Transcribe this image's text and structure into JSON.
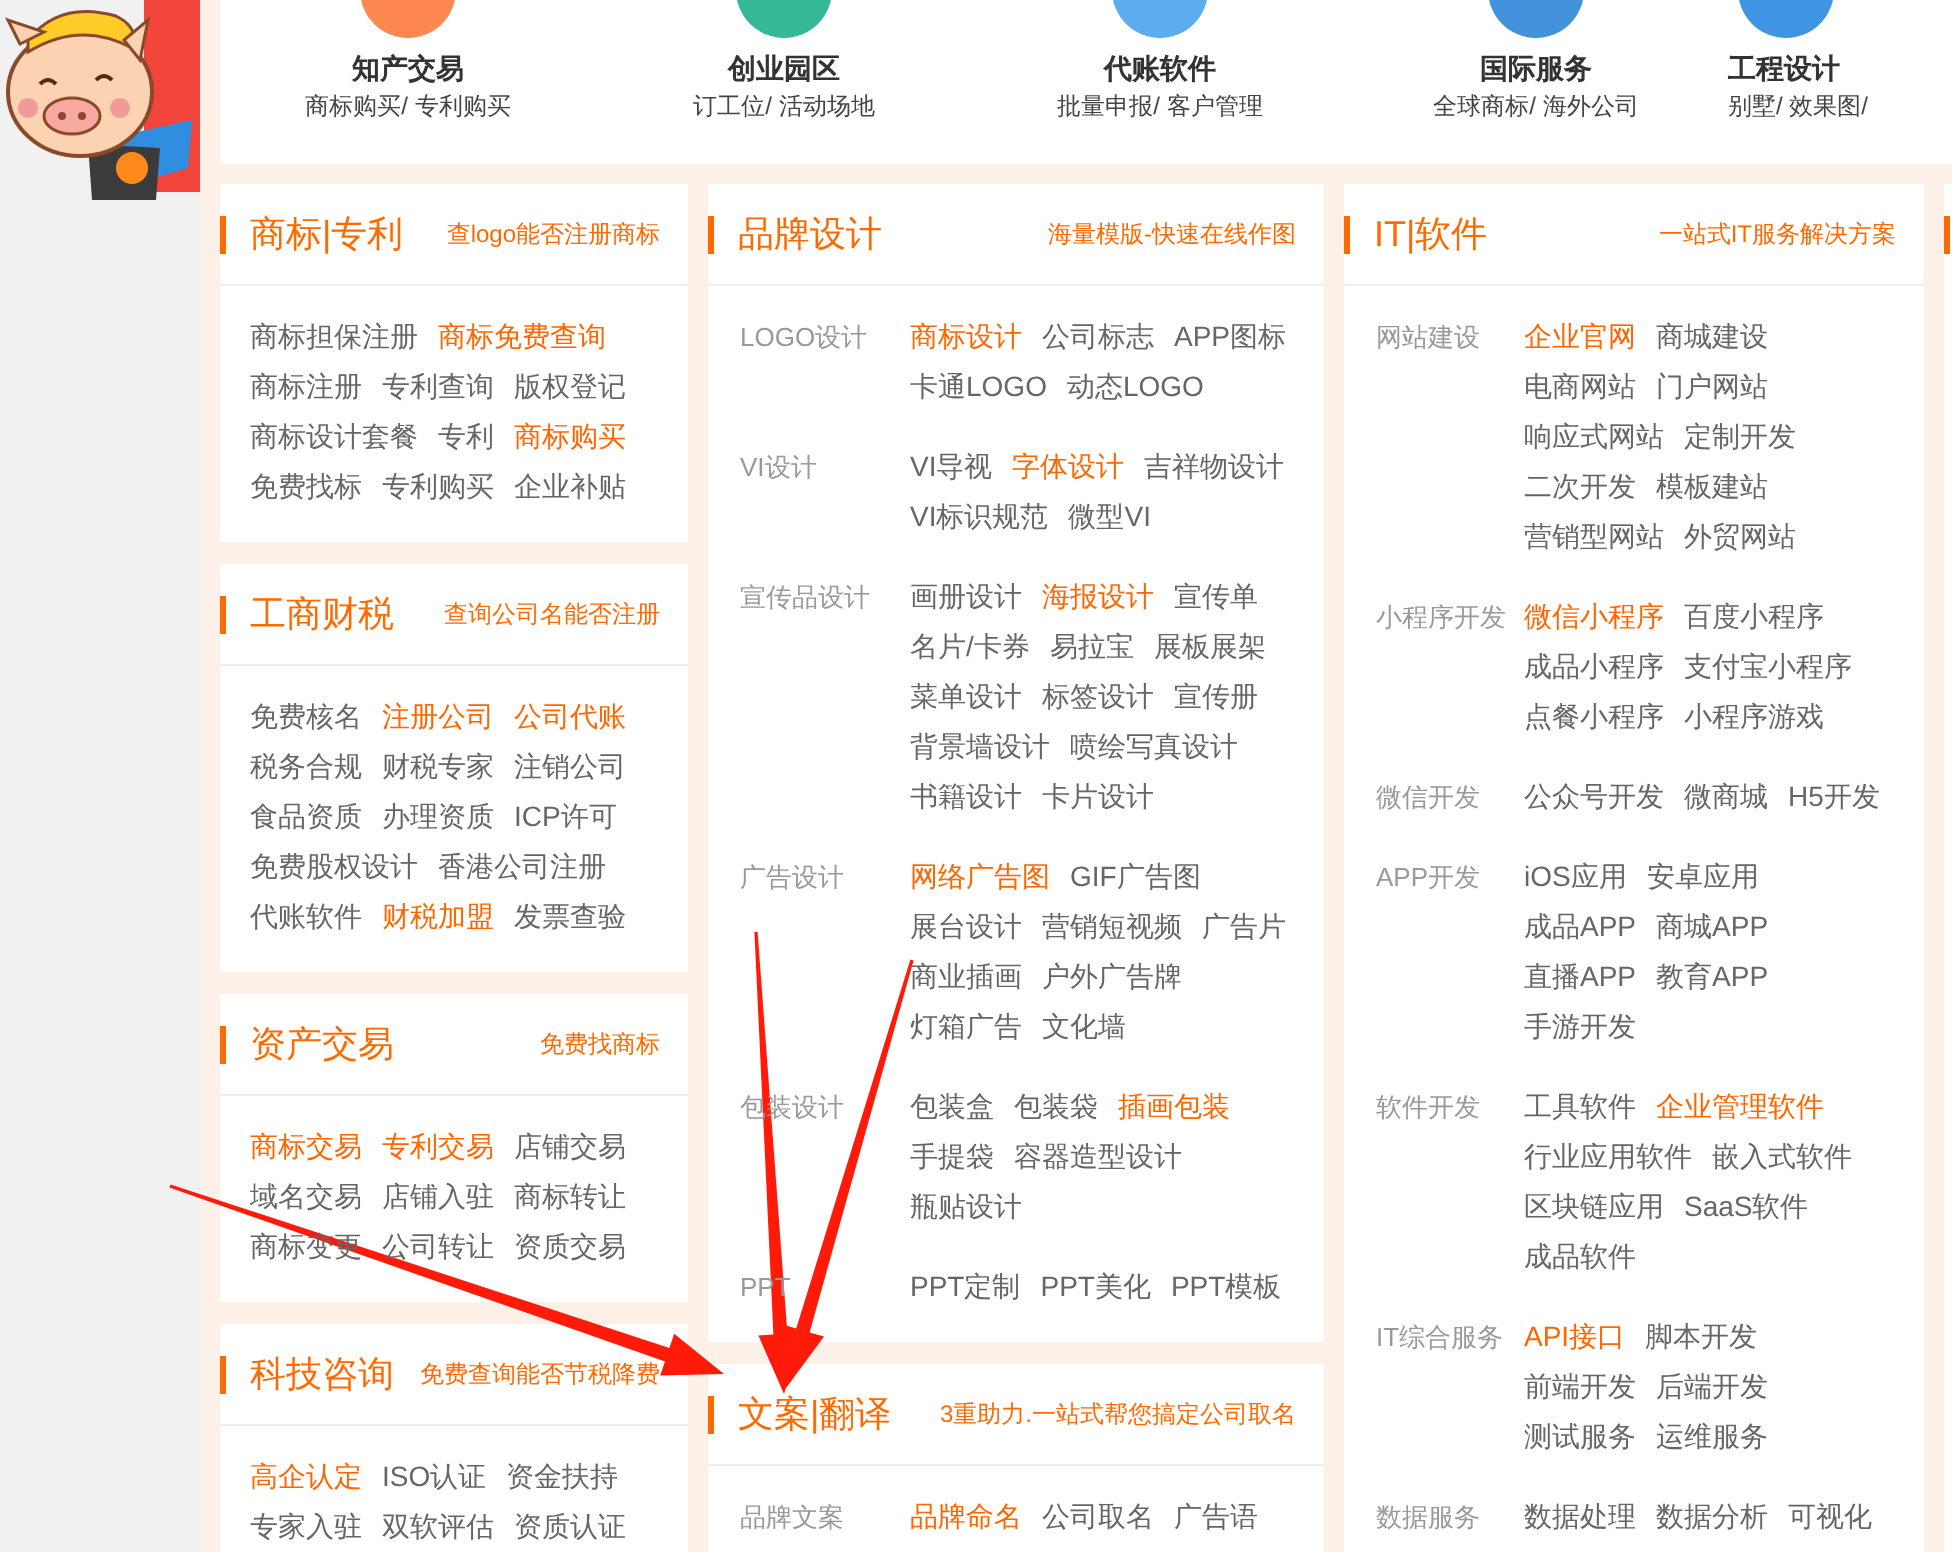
{
  "top_nav": [
    {
      "title": "知产交易",
      "subtitle": "商标购买/ 专利购买"
    },
    {
      "title": "创业园区",
      "subtitle": "订工位/ 活动场地"
    },
    {
      "title": "代账软件",
      "subtitle": "批量申报/ 客户管理"
    },
    {
      "title": "国际服务",
      "subtitle": "全球商标/ 海外公司"
    },
    {
      "title": "工程设计",
      "subtitle": "别墅/ 效果图/"
    }
  ],
  "columns": [
    {
      "cards": [
        {
          "title": "商标|专利",
          "tagline": "查logo能否注册商标",
          "groups": [
            {
              "rows": [
                [
                  {
                    "text": "商标担保注册",
                    "hot": false
                  },
                  {
                    "text": "商标免费查询",
                    "hot": true
                  }
                ],
                [
                  {
                    "text": "商标注册",
                    "hot": false
                  },
                  {
                    "text": "专利查询",
                    "hot": false
                  },
                  {
                    "text": "版权登记",
                    "hot": false
                  }
                ],
                [
                  {
                    "text": "商标设计套餐",
                    "hot": false
                  },
                  {
                    "text": "专利",
                    "hot": false
                  },
                  {
                    "text": "商标购买",
                    "hot": true
                  }
                ],
                [
                  {
                    "text": "免费找标",
                    "hot": false
                  },
                  {
                    "text": "专利购买",
                    "hot": false
                  },
                  {
                    "text": "企业补贴",
                    "hot": false
                  }
                ]
              ]
            }
          ]
        },
        {
          "title": "工商财税",
          "tagline": "查询公司名能否注册",
          "groups": [
            {
              "rows": [
                [
                  {
                    "text": "免费核名",
                    "hot": false
                  },
                  {
                    "text": "注册公司",
                    "hot": true
                  },
                  {
                    "text": "公司代账",
                    "hot": true
                  }
                ],
                [
                  {
                    "text": "税务合规",
                    "hot": false
                  },
                  {
                    "text": "财税专家",
                    "hot": false
                  },
                  {
                    "text": "注销公司",
                    "hot": false
                  }
                ],
                [
                  {
                    "text": "食品资质",
                    "hot": false
                  },
                  {
                    "text": "办理资质",
                    "hot": false
                  },
                  {
                    "text": "ICP许可",
                    "hot": false
                  }
                ],
                [
                  {
                    "text": "免费股权设计",
                    "hot": false
                  },
                  {
                    "text": "香港公司注册",
                    "hot": false
                  }
                ],
                [
                  {
                    "text": "代账软件",
                    "hot": false
                  },
                  {
                    "text": "财税加盟",
                    "hot": true
                  },
                  {
                    "text": "发票查验",
                    "hot": false
                  }
                ]
              ]
            }
          ]
        },
        {
          "title": "资产交易",
          "tagline": "免费找商标",
          "groups": [
            {
              "rows": [
                [
                  {
                    "text": "商标交易",
                    "hot": true
                  },
                  {
                    "text": "专利交易",
                    "hot": true
                  },
                  {
                    "text": "店铺交易",
                    "hot": false
                  }
                ],
                [
                  {
                    "text": "域名交易",
                    "hot": false
                  },
                  {
                    "text": "店铺入驻",
                    "hot": false
                  },
                  {
                    "text": "商标转让",
                    "hot": false
                  }
                ],
                [
                  {
                    "text": "商标变更",
                    "hot": false
                  },
                  {
                    "text": "公司转让",
                    "hot": false
                  },
                  {
                    "text": "资质交易",
                    "hot": false
                  }
                ]
              ]
            }
          ]
        },
        {
          "title": "科技咨询",
          "tagline": "免费查询能否节税降费",
          "groups": [
            {
              "rows": [
                [
                  {
                    "text": "高企认定",
                    "hot": true
                  },
                  {
                    "text": "ISO认证",
                    "hot": false
                  },
                  {
                    "text": "资金扶持",
                    "hot": false
                  }
                ],
                [
                  {
                    "text": "专家入驻",
                    "hot": false
                  },
                  {
                    "text": "双软评估",
                    "hot": false
                  },
                  {
                    "text": "资质认证",
                    "hot": false
                  }
                ]
              ]
            }
          ]
        }
      ]
    },
    {
      "cards": [
        {
          "title": "品牌设计",
          "tagline": "海量模版-快速在线作图",
          "groups": [
            {
              "label": "LOGO设计",
              "rows": [
                [
                  {
                    "text": "商标设计",
                    "hot": true
                  },
                  {
                    "text": "公司标志",
                    "hot": false
                  },
                  {
                    "text": "APP图标",
                    "hot": false
                  }
                ],
                [
                  {
                    "text": "卡通LOGO",
                    "hot": false
                  },
                  {
                    "text": "动态LOGO",
                    "hot": false
                  }
                ]
              ]
            },
            {
              "label": "VI设计",
              "rows": [
                [
                  {
                    "text": "VI导视",
                    "hot": false
                  },
                  {
                    "text": "字体设计",
                    "hot": true
                  },
                  {
                    "text": "吉祥物设计",
                    "hot": false
                  }
                ],
                [
                  {
                    "text": "VI标识规范",
                    "hot": false
                  },
                  {
                    "text": "微型VI",
                    "hot": false
                  }
                ]
              ]
            },
            {
              "label": "宣传品设计",
              "rows": [
                [
                  {
                    "text": "画册设计",
                    "hot": false
                  },
                  {
                    "text": "海报设计",
                    "hot": true
                  },
                  {
                    "text": "宣传单",
                    "hot": false
                  }
                ],
                [
                  {
                    "text": "名片/卡券",
                    "hot": false
                  },
                  {
                    "text": "易拉宝",
                    "hot": false
                  },
                  {
                    "text": "展板展架",
                    "hot": false
                  }
                ],
                [
                  {
                    "text": "菜单设计",
                    "hot": false
                  },
                  {
                    "text": "标签设计",
                    "hot": false
                  },
                  {
                    "text": "宣传册",
                    "hot": false
                  }
                ],
                [
                  {
                    "text": "背景墙设计",
                    "hot": false
                  },
                  {
                    "text": "喷绘写真设计",
                    "hot": false
                  }
                ],
                [
                  {
                    "text": "书籍设计",
                    "hot": false
                  },
                  {
                    "text": "卡片设计",
                    "hot": false
                  }
                ]
              ]
            },
            {
              "label": "广告设计",
              "rows": [
                [
                  {
                    "text": "网络广告图",
                    "hot": true
                  },
                  {
                    "text": "GIF广告图",
                    "hot": false
                  }
                ],
                [
                  {
                    "text": "展台设计",
                    "hot": false
                  },
                  {
                    "text": "营销短视频",
                    "hot": false
                  },
                  {
                    "text": "广告片",
                    "hot": false
                  }
                ],
                [
                  {
                    "text": "商业插画",
                    "hot": false
                  },
                  {
                    "text": "户外广告牌",
                    "hot": false
                  }
                ],
                [
                  {
                    "text": "灯箱广告",
                    "hot": false
                  },
                  {
                    "text": "文化墙",
                    "hot": false
                  }
                ]
              ]
            },
            {
              "label": "包装设计",
              "rows": [
                [
                  {
                    "text": "包装盒",
                    "hot": false
                  },
                  {
                    "text": "包装袋",
                    "hot": false
                  },
                  {
                    "text": "插画包装",
                    "hot": true
                  }
                ],
                [
                  {
                    "text": "手提袋",
                    "hot": false
                  },
                  {
                    "text": "容器造型设计",
                    "hot": false
                  }
                ],
                [
                  {
                    "text": "瓶贴设计",
                    "hot": false
                  }
                ]
              ]
            },
            {
              "label": "PPT",
              "rows": [
                [
                  {
                    "text": "PPT定制",
                    "hot": false
                  },
                  {
                    "text": "PPT美化",
                    "hot": false
                  },
                  {
                    "text": "PPT模板",
                    "hot": false
                  }
                ]
              ]
            }
          ]
        },
        {
          "title": "文案|翻译",
          "tagline": "3重助力.一站式帮您搞定公司取名",
          "groups": [
            {
              "label": "品牌文案",
              "rows": [
                [
                  {
                    "text": "品牌命名",
                    "hot": true
                  },
                  {
                    "text": "公司取名",
                    "hot": false
                  },
                  {
                    "text": "广告语",
                    "hot": false
                  }
                ]
              ]
            }
          ]
        }
      ]
    },
    {
      "cards": [
        {
          "title": "IT|软件",
          "tagline": "一站式IT服务解决方案",
          "groups": [
            {
              "label": "网站建设",
              "rows": [
                [
                  {
                    "text": "企业官网",
                    "hot": true
                  },
                  {
                    "text": "商城建设",
                    "hot": false
                  }
                ],
                [
                  {
                    "text": "电商网站",
                    "hot": false
                  },
                  {
                    "text": "门户网站",
                    "hot": false
                  }
                ],
                [
                  {
                    "text": "响应式网站",
                    "hot": false
                  },
                  {
                    "text": "定制开发",
                    "hot": false
                  }
                ],
                [
                  {
                    "text": "二次开发",
                    "hot": false
                  },
                  {
                    "text": "模板建站",
                    "hot": false
                  }
                ],
                [
                  {
                    "text": "营销型网站",
                    "hot": false
                  },
                  {
                    "text": "外贸网站",
                    "hot": false
                  }
                ]
              ]
            },
            {
              "label": "小程序开发",
              "rows": [
                [
                  {
                    "text": "微信小程序",
                    "hot": true
                  },
                  {
                    "text": "百度小程序",
                    "hot": false
                  }
                ],
                [
                  {
                    "text": "成品小程序",
                    "hot": false
                  },
                  {
                    "text": "支付宝小程序",
                    "hot": false
                  }
                ],
                [
                  {
                    "text": "点餐小程序",
                    "hot": false
                  },
                  {
                    "text": "小程序游戏",
                    "hot": false
                  }
                ]
              ]
            },
            {
              "label": "微信开发",
              "rows": [
                [
                  {
                    "text": "公众号开发",
                    "hot": false
                  },
                  {
                    "text": "微商城",
                    "hot": false
                  },
                  {
                    "text": "H5开发",
                    "hot": false
                  }
                ]
              ]
            },
            {
              "label": "APP开发",
              "rows": [
                [
                  {
                    "text": "iOS应用",
                    "hot": false
                  },
                  {
                    "text": "安卓应用",
                    "hot": false
                  }
                ],
                [
                  {
                    "text": "成品APP",
                    "hot": false
                  },
                  {
                    "text": "商城APP",
                    "hot": false
                  }
                ],
                [
                  {
                    "text": "直播APP",
                    "hot": false
                  },
                  {
                    "text": "教育APP",
                    "hot": false
                  }
                ],
                [
                  {
                    "text": "手游开发",
                    "hot": false
                  }
                ]
              ]
            },
            {
              "label": "软件开发",
              "rows": [
                [
                  {
                    "text": "工具软件",
                    "hot": false
                  },
                  {
                    "text": "企业管理软件",
                    "hot": true
                  }
                ],
                [
                  {
                    "text": "行业应用软件",
                    "hot": false
                  },
                  {
                    "text": "嵌入式软件",
                    "hot": false
                  }
                ],
                [
                  {
                    "text": "区块链应用",
                    "hot": false
                  },
                  {
                    "text": "SaaS软件",
                    "hot": false
                  }
                ],
                [
                  {
                    "text": "成品软件",
                    "hot": false
                  }
                ]
              ]
            },
            {
              "label": "IT综合服务",
              "rows": [
                [
                  {
                    "text": "API接口",
                    "hot": true
                  },
                  {
                    "text": "脚本开发",
                    "hot": false
                  }
                ],
                [
                  {
                    "text": "前端开发",
                    "hot": false
                  },
                  {
                    "text": "后端开发",
                    "hot": false
                  }
                ],
                [
                  {
                    "text": "测试服务",
                    "hot": false
                  },
                  {
                    "text": "运维服务",
                    "hot": false
                  }
                ]
              ]
            },
            {
              "label": "数据服务",
              "rows": [
                [
                  {
                    "text": "数据处理",
                    "hot": false
                  },
                  {
                    "text": "数据分析",
                    "hot": false
                  },
                  {
                    "text": "可视化",
                    "hot": false
                  }
                ]
              ]
            }
          ]
        }
      ]
    }
  ]
}
